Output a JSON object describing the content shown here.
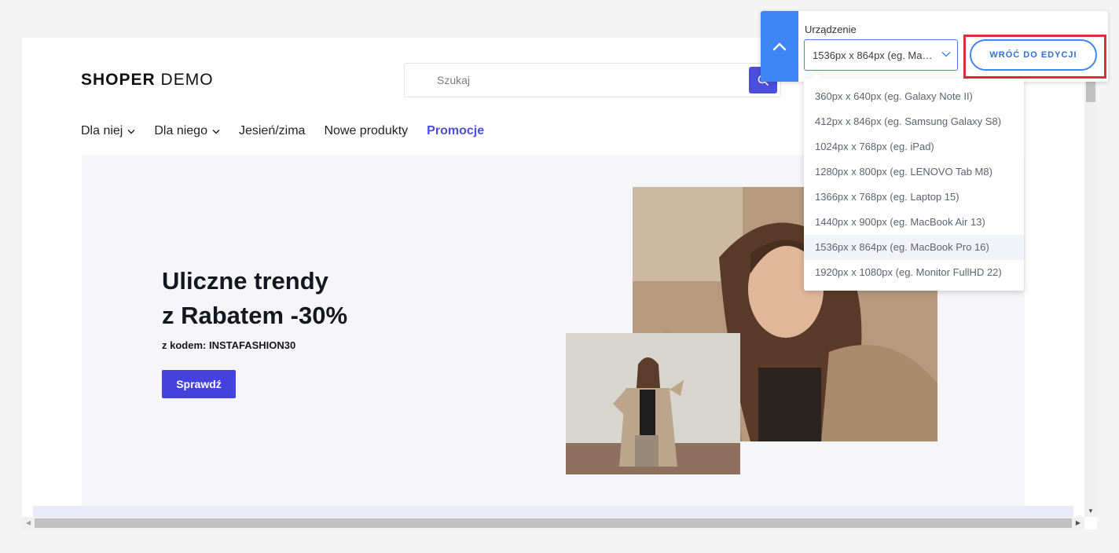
{
  "store": {
    "logo_bold": "SHOPER",
    "logo_light": "DEMO",
    "search_placeholder": "Szukaj",
    "nav": [
      {
        "label": "Dla niej",
        "has_chevron": true
      },
      {
        "label": "Dla niego",
        "has_chevron": true
      },
      {
        "label": "Jesień/zima",
        "has_chevron": false
      },
      {
        "label": "Nowe produkty",
        "has_chevron": false
      },
      {
        "label": "Promocje",
        "has_chevron": false,
        "highlighted": true
      }
    ],
    "hero": {
      "title_line1": "Uliczne trendy",
      "title_line2": "z Rabatem -30%",
      "subtitle": "z kodem: INSTAFASHION30",
      "cta": "Sprawdź"
    }
  },
  "device_panel": {
    "label": "Urządzenie",
    "selected_value": "1536px x 864px (eg. MacBook Pro 16)",
    "back_button": "WRÓĆ DO EDYCJI",
    "options": [
      "360px x 640px (eg. Galaxy Note II)",
      "412px x 846px (eg. Samsung Galaxy S8)",
      "1024px x 768px (eg. iPad)",
      "1280px x 800px (eg. LENOVO Tab M8)",
      "1366px x 768px (eg. Laptop 15)",
      "1440px x 900px (eg. MacBook Air 13)",
      "1536px x 864px (eg. MacBook Pro 16)",
      "1920px x 1080px (eg. Monitor FullHD 22)"
    ],
    "selected_index": 6
  },
  "colors": {
    "accent": "#4c4fdb",
    "panel_blue": "#3e86f5",
    "highlight_red": "#d9303c"
  }
}
